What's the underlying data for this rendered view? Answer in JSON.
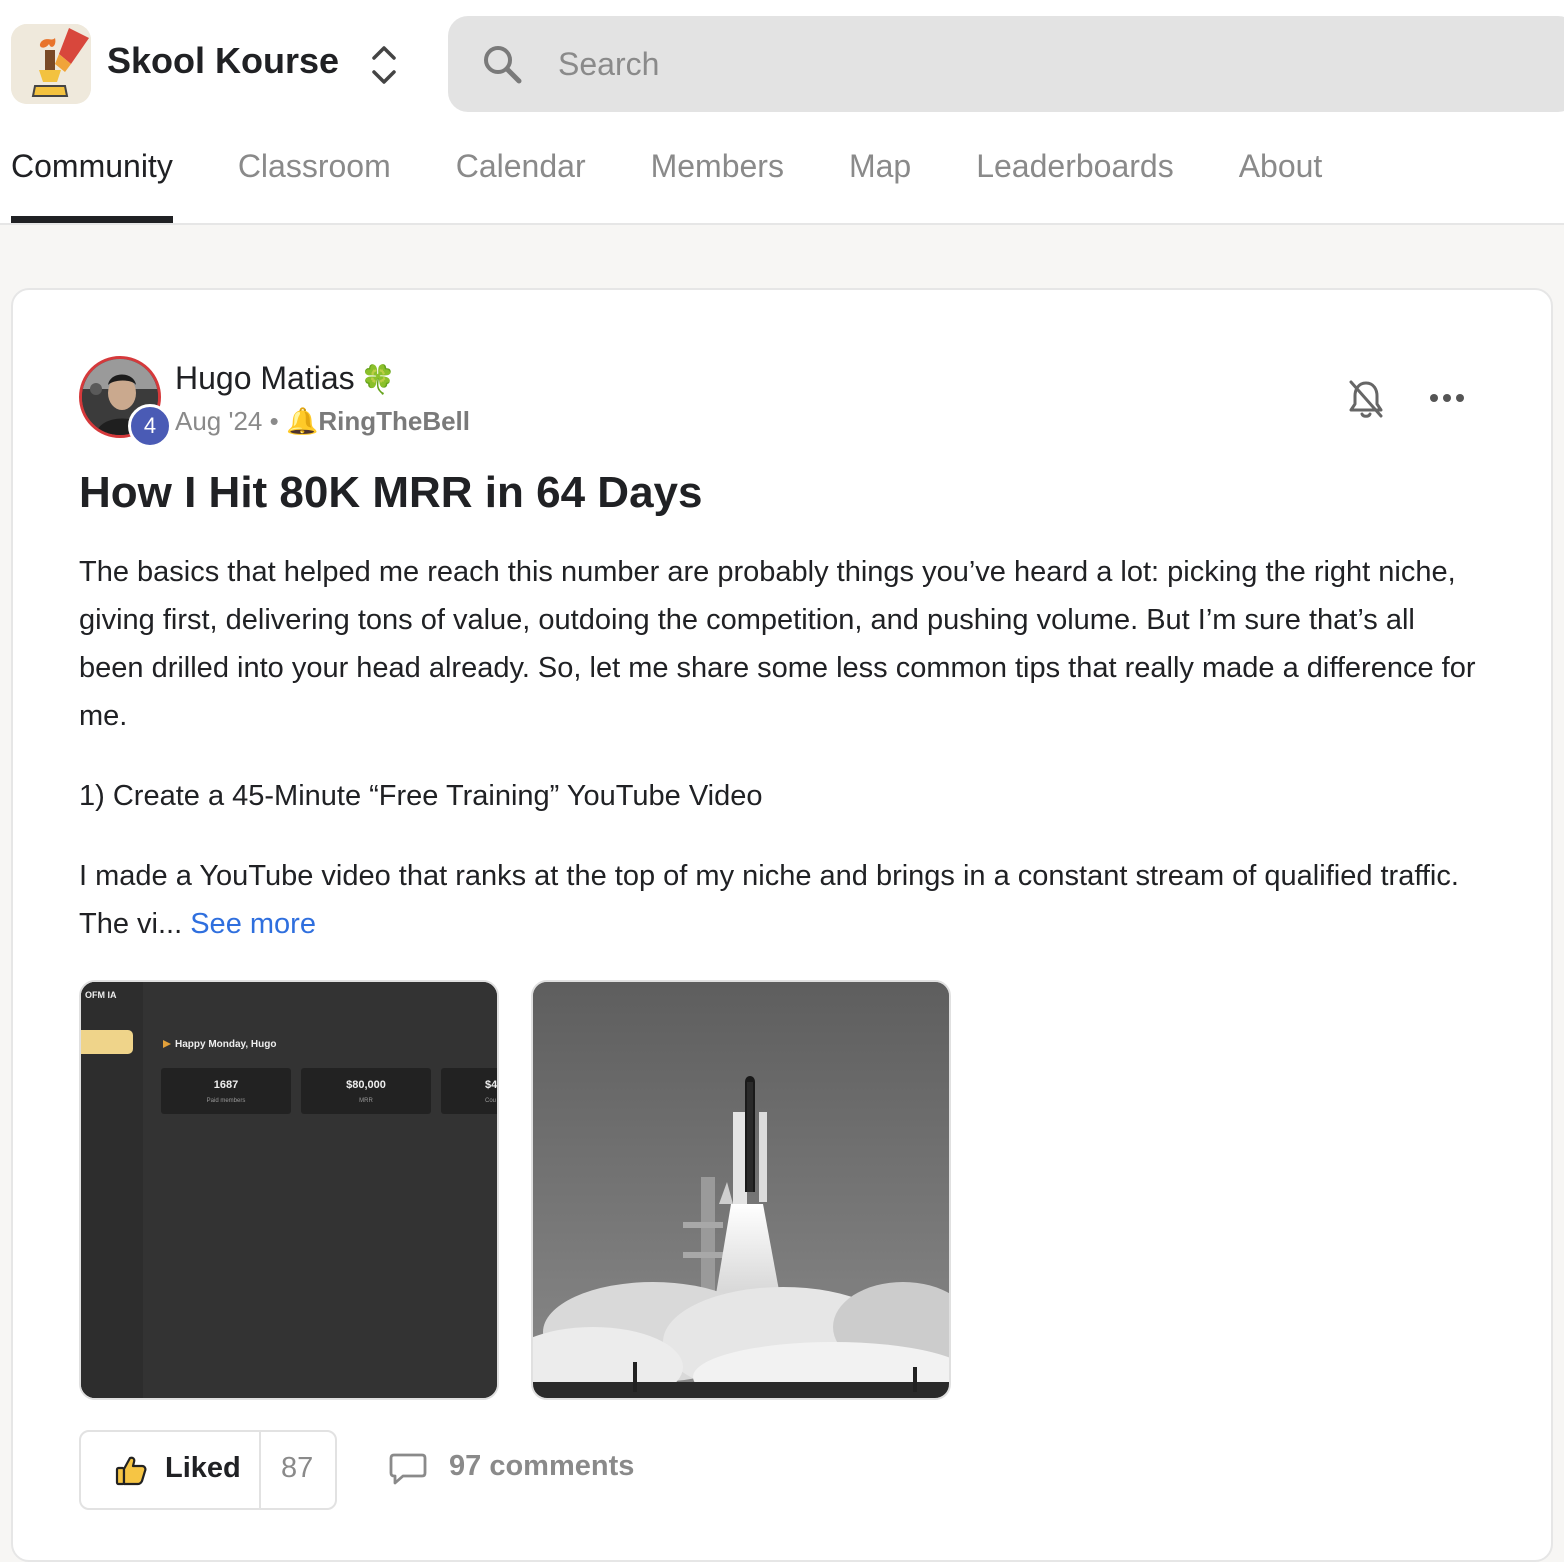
{
  "header": {
    "app_name": "Skool Kourse",
    "search_placeholder": "Search"
  },
  "tabs": [
    {
      "label": "Community",
      "active": true
    },
    {
      "label": "Classroom",
      "active": false
    },
    {
      "label": "Calendar",
      "active": false
    },
    {
      "label": "Members",
      "active": false
    },
    {
      "label": "Map",
      "active": false
    },
    {
      "label": "Leaderboards",
      "active": false
    },
    {
      "label": "About",
      "active": false
    }
  ],
  "post": {
    "author": "Hugo Matias",
    "author_emoji": "🍀",
    "level": "4",
    "date": "Aug '24",
    "separator": "•",
    "category_emoji": "🔔",
    "category": "RingTheBell",
    "title": "How I Hit 80K MRR in 64 Days",
    "paragraph1": "The basics that helped me reach this number are probably things you’ve heard a lot: picking the right niche, giving first, delivering tons of value, outdoing the competition, and pushing volume. But I’m sure that’s all been drilled into your head already. So, let me share some less common tips that really made a difference for me.",
    "paragraph2": "1) Create a 45-Minute “Free Training” YouTube Video",
    "paragraph3": "I made a YouTube video that ranks at the top of my niche and brings in a constant stream of qualified traffic. The vi...",
    "see_more": "See more",
    "attachment1": {
      "corner_label": "OFM IA",
      "greeting": "Happy Monday, Hugo",
      "stat1_value": "1687",
      "stat1_label": "Paid members",
      "stat2_value": "$80,000",
      "stat2_label": "MRR",
      "stat3_value": "$4",
      "stat3_label": "Cou"
    },
    "likes": {
      "label": "Liked",
      "count": "87"
    },
    "comments_label": "97 comments"
  },
  "colors": {
    "accent_link": "#2f6fde",
    "level_badge": "#4a5bb5",
    "avatar_ring": "#d5393b",
    "background": "#f7f6f4"
  },
  "icons": [
    "logo-trophy-icon",
    "switcher-chevrons-icon",
    "search-icon",
    "bell-off-icon",
    "more-dots-icon",
    "thumbs-up-icon",
    "comment-icon"
  ]
}
